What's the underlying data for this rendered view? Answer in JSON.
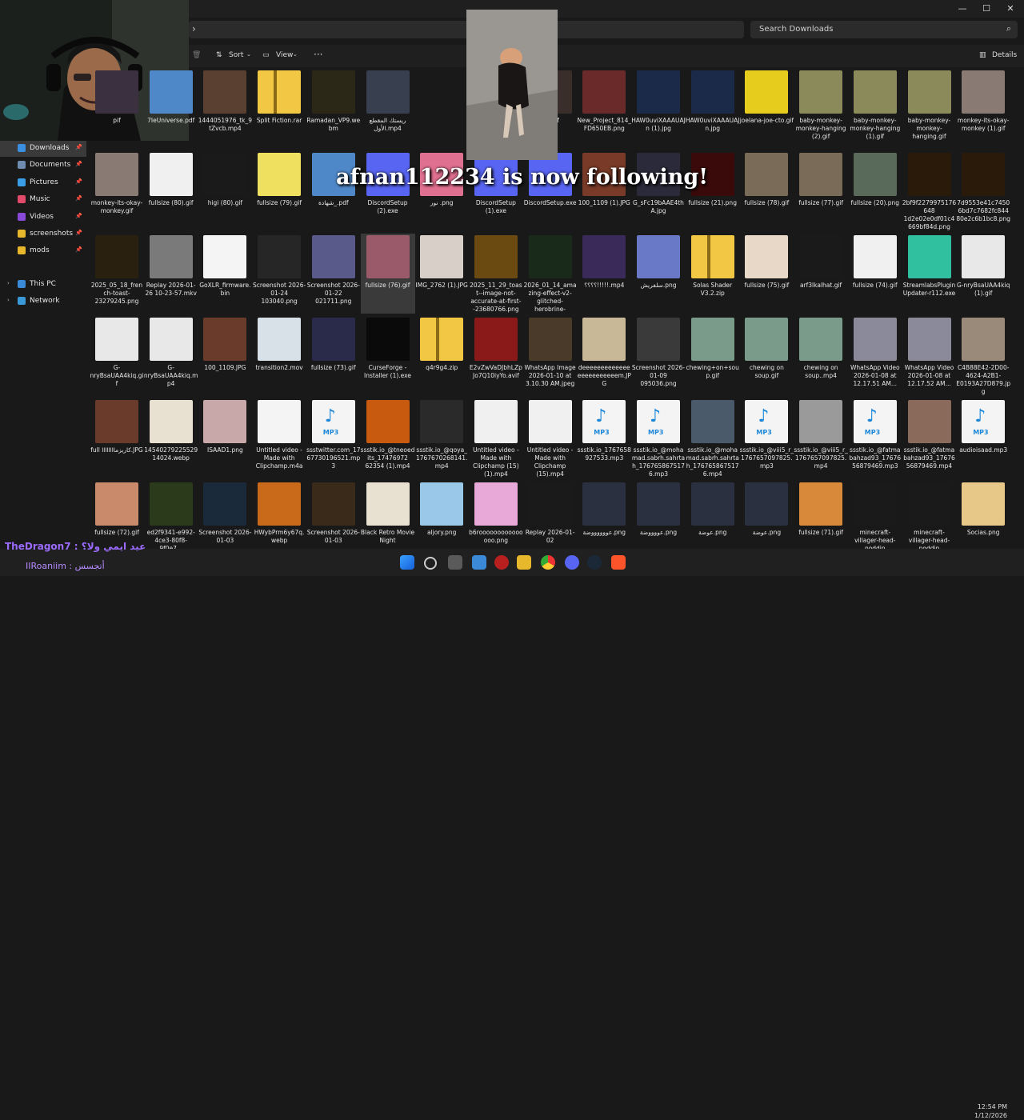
{
  "window": {
    "minimize": "—",
    "maximize": "☐",
    "close": "✕"
  },
  "search": {
    "placeholder": "Search Downloads"
  },
  "toolbar": {
    "sort": "Sort",
    "view": "View",
    "more": "···",
    "details": "Details"
  },
  "sidebar": {
    "quick": [
      {
        "label": "Downloads",
        "color": "#3b8fe0"
      },
      {
        "label": "Documents",
        "color": "#6e8bb0"
      },
      {
        "label": "Pictures",
        "color": "#3a9fe8"
      },
      {
        "label": "Music",
        "color": "#e24a6a"
      },
      {
        "label": "Videos",
        "color": "#8a4ad8"
      },
      {
        "label": "screenshots",
        "color": "#e8b82c"
      },
      {
        "label": "mods",
        "color": "#e8b82c"
      }
    ],
    "thispc": "This PC",
    "network": "Network"
  },
  "overlay": {
    "follow_text": "afnan112234 is now following!",
    "chat_user": "TheDragon7 : عيد ايمي ولا؟",
    "chat_msg": "IIRoaniim :  أتجسس"
  },
  "clock": {
    "time": "12:54 PM",
    "date": "1/12/2026"
  },
  "files": [
    [
      {
        "name": "pif",
        "t": "img",
        "c": "#3a3040"
      },
      {
        "name": "7IeUniverse.pdf",
        "t": "img",
        "c": "#4f88c8"
      },
      {
        "name": "1444051976_tk_9tZvcb.mp4",
        "t": "img",
        "c": "#5a4030"
      },
      {
        "name": "Split Fiction.rar",
        "t": "folder",
        "c": "#e8b82c"
      },
      {
        "name": "Ramadan_VP9.webm",
        "t": "img",
        "c": "#2c2818"
      },
      {
        "name": "ريستك المقطع الأول.mp4",
        "t": "img",
        "c": "#384050"
      },
      {
        "name": "",
        "t": "none",
        "c": ""
      },
      {
        "name": "",
        "t": "none",
        "c": ""
      },
      {
        "name": "(1).gif",
        "t": "img",
        "c": "#3a2e2a"
      },
      {
        "name": "New_Project_814_FD650EB.png",
        "t": "img",
        "c": "#6a2a2a"
      },
      {
        "name": "HAW0uviXAAAUAJn (1).jpg",
        "t": "img",
        "c": "#1c2a4a"
      },
      {
        "name": "HAW0uviXAAAUAJn.jpg",
        "t": "img",
        "c": "#1c2a4a"
      },
      {
        "name": "joelana-joe-cto.gif",
        "t": "img",
        "c": "#e6cc1c"
      },
      {
        "name": "baby-monkey-monkey-hanging (2).gif",
        "t": "img",
        "c": "#8a8a5a"
      },
      {
        "name": "baby-monkey-monkey-hanging (1).gif",
        "t": "img",
        "c": "#8a8a5a"
      },
      {
        "name": "baby-monkey-monkey-hanging.gif",
        "t": "img",
        "c": "#8a8a5a"
      },
      {
        "name": "monkey-its-okay-monkey (1).gif",
        "t": "img",
        "c": "#8a7a74"
      }
    ],
    [
      {
        "name": "monkey-its-okay-monkey.gif",
        "t": "img",
        "c": "#8a7a74"
      },
      {
        "name": "fullsize (80).gif",
        "t": "img",
        "c": "#f0f0f0"
      },
      {
        "name": "higi (80).gif",
        "t": "img",
        "c": "#1a1a1a"
      },
      {
        "name": "fullsize (79).gif",
        "t": "img",
        "c": "#f0e060"
      },
      {
        "name": "شهادة_.pdf",
        "t": "img",
        "c": "#4f88c8"
      },
      {
        "name": "DiscordSetup (2).exe",
        "t": "img",
        "c": "#5865f2"
      },
      {
        "name": "نور .png",
        "t": "img",
        "c": "#e07090"
      },
      {
        "name": "DiscordSetup (1).exe",
        "t": "img",
        "c": "#5865f2"
      },
      {
        "name": "DiscordSetup.exe",
        "t": "img",
        "c": "#5865f2"
      },
      {
        "name": "100_1109 (1).JPG",
        "t": "img",
        "c": "#7a3a28"
      },
      {
        "name": "G_sFc19bAAE4thA.jpg",
        "t": "img",
        "c": "#2a2a3a"
      },
      {
        "name": "fullsize (21).png",
        "t": "img",
        "c": "#3a0a0a"
      },
      {
        "name": "fullsize (78).gif",
        "t": "img",
        "c": "#7a6a58"
      },
      {
        "name": "fullsize (77).gif",
        "t": "img",
        "c": "#7a6a58"
      },
      {
        "name": "fullsize (20).png",
        "t": "img",
        "c": "#5a6a5a"
      },
      {
        "name": "2bf9f2279975176648 1d2e02e0df01c4669bf84d.png",
        "t": "img",
        "c": "#2a1a0a"
      },
      {
        "name": "7d9553e41c74506bd7c7682fc84480e2c6b1bc8.png",
        "t": "img",
        "c": "#2a1a0a"
      }
    ],
    [
      {
        "name": "2025_05_18_french-toast-23279245.png",
        "t": "img",
        "c": "#2a2010"
      },
      {
        "name": "Replay 2026-01-26 10-23-57.mkv",
        "t": "img",
        "c": "#7a7a7a"
      },
      {
        "name": "GoXLR_firmware.bin",
        "t": "doc",
        "c": "#f4f4f4"
      },
      {
        "name": "Screenshot 2026-01-24 103040.png",
        "t": "img",
        "c": "#262626"
      },
      {
        "name": "Screenshot 2026-01-22 021711.png",
        "t": "img",
        "c": "#5a5a8a"
      },
      {
        "name": "fullsize (76).gif",
        "t": "img",
        "c": "#9a5a6a"
      },
      {
        "name": "IMG_2762 (1).JPG",
        "t": "img",
        "c": "#d8d0c8"
      },
      {
        "name": "2025_11_29_toast--image-not-accurate-at-first--23680766.png",
        "t": "img",
        "c": "#6a4a10"
      },
      {
        "name": "2026_01_14_amazing-effect-v2-glitched-herobrine-23792382.png",
        "t": "img",
        "c": "#1a2a1a"
      },
      {
        "name": "؟؟؟؟!!!!!.mp4",
        "t": "img",
        "c": "#3a2a5a"
      },
      {
        "name": "سلفريش.png",
        "t": "img",
        "c": "#6a78c8"
      },
      {
        "name": "Solas Shader V3.2.zip",
        "t": "folder",
        "c": "#e8b82c"
      },
      {
        "name": "fullsize (75).gif",
        "t": "img",
        "c": "#e8d8c8"
      },
      {
        "name": "arf3lkalhat.gif",
        "t": "img",
        "c": "#1a1a1a"
      },
      {
        "name": "fullsize (74).gif",
        "t": "img",
        "c": "#f0f0f0"
      },
      {
        "name": "StreamlabsPluginUpdater-r112.exe",
        "t": "img",
        "c": "#30c0a0"
      },
      {
        "name": "G-nryBsaUAA4kiq (1).gif",
        "t": "img",
        "c": "#e8e8e8"
      }
    ],
    [
      {
        "name": "G-nryBsaUAA4kiq.gif",
        "t": "img",
        "c": "#e8e8e8"
      },
      {
        "name": "G-nryBsaUAA4kiq.mp4",
        "t": "img",
        "c": "#e8e8e8"
      },
      {
        "name": "100_1109.JPG",
        "t": "img",
        "c": "#6a3a2a"
      },
      {
        "name": "transition2.mov",
        "t": "img",
        "c": "#d8e0e8"
      },
      {
        "name": "fullsize (73).gif",
        "t": "img",
        "c": "#2a2a4a"
      },
      {
        "name": "CurseForge - Installer (1).exe",
        "t": "img",
        "c": "#0a0a0a"
      },
      {
        "name": "q4r9g4.zip",
        "t": "folder",
        "c": "#e8b82c"
      },
      {
        "name": "E2vZwVaDJbhLZpJo7Q10iyYo.avif",
        "t": "img",
        "c": "#8a1a1a"
      },
      {
        "name": "WhatsApp Image 2026-01-10 at 3.10.30 AM.jpeg",
        "t": "img",
        "c": "#4a3a2a"
      },
      {
        "name": "deeeeeeeeeeeeeeeeeeeeeeeem.JPG",
        "t": "img",
        "c": "#c8b898"
      },
      {
        "name": "Screenshot 2026-01-09 095036.png",
        "t": "img",
        "c": "#3a3a3a"
      },
      {
        "name": "chewing+on+soup.gif",
        "t": "img",
        "c": "#7a9a8a"
      },
      {
        "name": "chewing on soup.gif",
        "t": "img",
        "c": "#7a9a8a"
      },
      {
        "name": "chewing on soup..mp4",
        "t": "img",
        "c": "#7a9a8a"
      },
      {
        "name": "WhatsApp Video 2026-01-08 at 12.17.51 AM...",
        "t": "img",
        "c": "#8a8a9a"
      },
      {
        "name": "WhatsApp Video 2026-01-08 at 12.17.52 AM...",
        "t": "img",
        "c": "#8a8a9a"
      },
      {
        "name": "C4B88E42-2D00-4624-A2B1-E0193A27D879.jpg",
        "t": "img",
        "c": "#9a8a7a"
      }
    ],
    [
      {
        "name": "full كاريزماااااااا.JPG",
        "t": "img",
        "c": "#6a3a2a"
      },
      {
        "name": "14540279225529 14024.webp",
        "t": "img",
        "c": "#e8e0d0"
      },
      {
        "name": "ISAAD1.png",
        "t": "img",
        "c": "#c8a8a8"
      },
      {
        "name": "Untitled video - Made with Clipchamp.m4a",
        "t": "doc",
        "c": "#f4f4f4"
      },
      {
        "name": "ssstwitter.com_1767730196521.mp3",
        "t": "mp3",
        "c": "#f4f4f4"
      },
      {
        "name": "ssstik.io_@tneoedits_17476972 62354 (1).mp4",
        "t": "img",
        "c": "#c85a10"
      },
      {
        "name": "ssstik.io_@qoya_1767670268141.mp4",
        "t": "img",
        "c": "#2a2a2a"
      },
      {
        "name": "Untitled video - Made with Clipchamp (15) (1).mp4",
        "t": "img",
        "c": "#f0f0f0"
      },
      {
        "name": "Untitled video - Made with Clipchamp (15).mp4",
        "t": "img",
        "c": "#f0f0f0"
      },
      {
        "name": "ssstik.io_1767658927533.mp3",
        "t": "mp3",
        "c": "#f4f4f4"
      },
      {
        "name": "ssstik.io_@mohamad.sabrh.sahrtah_1767658675176.mp3",
        "t": "mp3",
        "c": "#f4f4f4"
      },
      {
        "name": "ssstik.io_@mohamad.sabrh.sahrtah_1767658675176.mp4",
        "t": "img",
        "c": "#4a5a6a"
      },
      {
        "name": "ssstik.io_@viii5_r_1767657097825.mp3",
        "t": "mp3",
        "c": "#f4f4f4"
      },
      {
        "name": "ssstik.io_@viii5_r_1767657097825.mp4",
        "t": "img",
        "c": "#9a9a9a"
      },
      {
        "name": "ssstik.io_@fatmabahzad93_1767656879469.mp3",
        "t": "mp3",
        "c": "#f4f4f4"
      },
      {
        "name": "ssstik.io_@fatmabahzad93_1767656879469.mp4",
        "t": "img",
        "c": "#8a6a5a"
      },
      {
        "name": "audioisaad.mp3",
        "t": "mp3",
        "c": "#f4f4f4"
      }
    ],
    [
      {
        "name": "fullsize (72).gif",
        "t": "img",
        "c": "#c88a6a"
      },
      {
        "name": "ed2f9341-e992-4ce3-80f8-9f0e7...",
        "t": "img",
        "c": "#2a3a1a"
      },
      {
        "name": "Screenshot 2026-01-03",
        "t": "img",
        "c": "#1a2a3a"
      },
      {
        "name": "HWybPrm6y67q.webp",
        "t": "img",
        "c": "#c86a1a"
      },
      {
        "name": "Screenshot 2026-01-03",
        "t": "img",
        "c": "#3a2a1a"
      },
      {
        "name": "Black Retro Movie Night",
        "t": "img",
        "c": "#e8e0d0"
      },
      {
        "name": "aljory.png",
        "t": "img",
        "c": "#9ac8e8"
      },
      {
        "name": "b6rooooooooooooooo.png",
        "t": "img",
        "c": "#e8a8d8"
      },
      {
        "name": "Replay 2026-01-02",
        "t": "img",
        "c": "#1a1a1a"
      },
      {
        "name": "عووووووضة.png",
        "t": "img",
        "c": "#2a3040"
      },
      {
        "name": "عووووضة.png",
        "t": "img",
        "c": "#2a3040"
      },
      {
        "name": "عوضة.png",
        "t": "img",
        "c": "#2a3040"
      },
      {
        "name": "عوضة.png",
        "t": "img",
        "c": "#2a3040"
      },
      {
        "name": "fullsize (71).gif",
        "t": "img",
        "c": "#d88a3a"
      },
      {
        "name": "minecraft-villager-head-noddin",
        "t": "img",
        "c": "#1a1a1a"
      },
      {
        "name": "minecraft-villager-head-noddin",
        "t": "img",
        "c": "#1a1a1a"
      },
      {
        "name": "Socias.png",
        "t": "img",
        "c": "#e8c888"
      }
    ]
  ]
}
